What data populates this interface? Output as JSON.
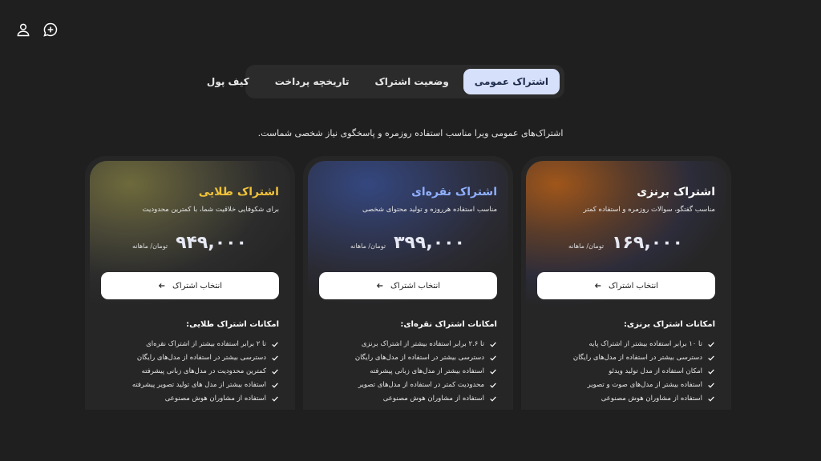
{
  "header": {
    "icons": [
      "new-chat-icon",
      "user-icon"
    ]
  },
  "tabs": [
    {
      "label": "اشتراک عمومی",
      "active": true
    },
    {
      "label": "وضعیت اشتراک",
      "active": false
    },
    {
      "label": "تاریخچه پرداخت",
      "active": false
    },
    {
      "label": "کیف پول",
      "active": false
    }
  ],
  "subtitle": "اشتراک‌های عمومی ویرا مناسب استفاده روزمره و پاسخگوی نیاز شخصی شماست.",
  "plans": [
    {
      "title": "اشتراک برنزی",
      "description": "مناسب گفتگو، سوالات روزمره و استفاده کمتر",
      "price": "۱۶۹,۰۰۰",
      "price_unit": "تومان/ ماهانه",
      "button_label": "انتخاب اشتراک",
      "features_title": "امکانات اشتراک برنزی:",
      "features": [
        "تا ۱۰ برابر استفاده بیشتر از اشتراک پایه",
        "دسترسی بیشتر در استفاده از مدل‌های رایگان",
        "امکان استفاده از مدل تولید ویدئو",
        "استفاده بیشتر از مدل‌های صوت و تصویر",
        "استفاده از مشاوران هوش مصنوعی"
      ],
      "accent": "#b8621c"
    },
    {
      "title": "اشتراک نقره‌ای",
      "description": "مناسب استفاده هرروزه و تولید محتوای شخصی",
      "price": "۳۹۹,۰۰۰",
      "price_unit": "تومان/ ماهانه",
      "button_label": "انتخاب اشتراک",
      "features_title": "امکانات اشتراک نقره‌ای:",
      "features": [
        "تا ۲.۶ برابر استفاده بیشتر از اشتراک برنزی",
        "دسترسی بیشتر در استفاده از مدل‌های رایگان",
        "استفاده بیشتر از مدل‌های زبانی پیشرفته",
        "محدودیت کمتر در استفاده از مدل‌های تصویر",
        "استفاده از مشاوران هوش مصنوعی"
      ],
      "accent": "#3a4f9a"
    },
    {
      "title": "اشتراک طلایی",
      "description": "برای شکوفایی خلاقیت شما، با کمترین محدودیت",
      "price": "۹۴۹,۰۰۰",
      "price_unit": "تومان/ ماهانه",
      "button_label": "انتخاب اشتراک",
      "features_title": "امکانات اشتراک طلایی:",
      "features": [
        "تا ۲ برابر استفاده بیشتر از اشتراک نقره‌ای",
        "دسترسی بیشتر در استفاده از مدل‌های رایگان",
        "کمترین محدودیت در مدل‌های زبانی پیشرفته",
        "استفاده بیشتر از مدل های تولید تصویر پیشرفته",
        "استفاده از مشاوران هوش مصنوعی"
      ],
      "accent": "#8a8242"
    }
  ]
}
